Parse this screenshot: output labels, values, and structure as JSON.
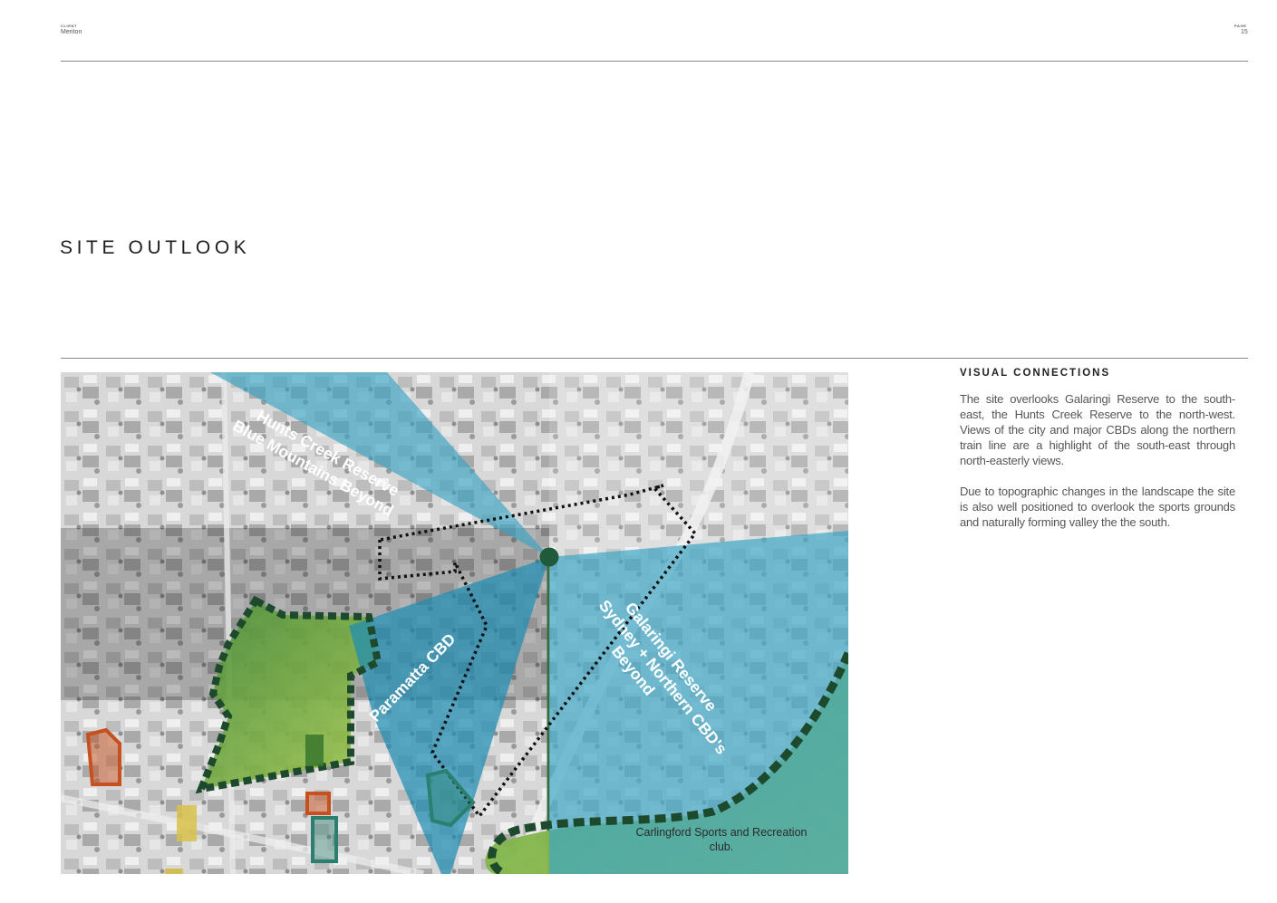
{
  "header": {
    "client_label": "CLIENT",
    "client_value": "Meriton",
    "page_label": "PAGE",
    "page_value": "15"
  },
  "page_title": "SITE OUTLOOK",
  "map": {
    "labels": {
      "hunts_line1": "Hunts Creek Reserve",
      "hunts_line2": "Blue Mountains Beyond",
      "paramatta": "Paramatta CBD",
      "galaringi_line1": "Galaringi Reserve",
      "galaringi_line2": "Sydney + Northern CBD's",
      "galaringi_line3": "Beyond",
      "carlingford_line1": "Carlingford Sports and Recreation",
      "carlingford_line2": "club."
    },
    "colors": {
      "view_cone": "#3aa3c4",
      "green_space": "#5f9e2e",
      "dashed_boundary": "#1d4a2c",
      "marker": "#1f5a3a",
      "orange_building": "#c6501f",
      "teal_building": "#2a7f6f",
      "yellow_building": "#d9c24a"
    }
  },
  "sidebar": {
    "heading": "VISUAL CONNECTIONS",
    "paragraph1": "The site overlooks Galaringi Reserve to the south-east, the Hunts Creek Reserve to the north-west. Views of the city and major CBDs along the northern train line are a highlight of the south-east through north-easterly views.",
    "paragraph2": "Due to topographic changes in the landscape the site is also well positioned to overlook the sports grounds and naturally forming valley the the south."
  }
}
